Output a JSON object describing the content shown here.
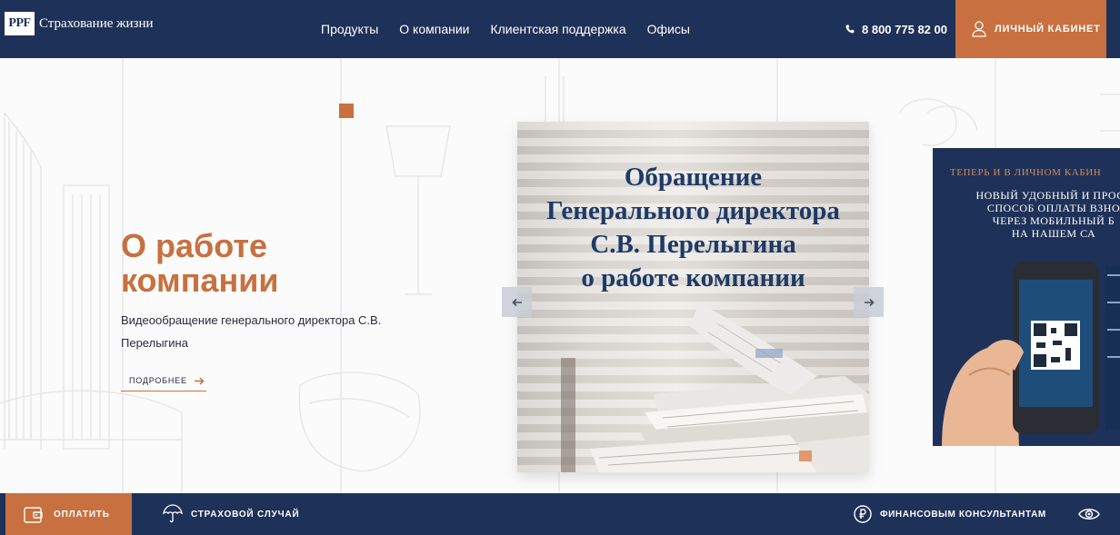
{
  "header": {
    "logo_mark": "PPF",
    "logo_text": "Страхование жизни",
    "nav": [
      "Продукты",
      "О компании",
      "Клиентская поддержка",
      "Офисы"
    ],
    "phone": "8 800 775 82 00",
    "cabinet_label": "ЛИЧНЫЙ КАБИНЕТ"
  },
  "hero": {
    "title_line1": "О работе",
    "title_line2": "компании",
    "description": "Видеообращение генерального директора С.В. Перелыгина",
    "more_label": "ПОДРОБНЕЕ"
  },
  "slider": {
    "main_slide": {
      "line1": "Обращение",
      "line2": "Генерального директора",
      "line3": "С.В. Перелыгина",
      "line4": "о работе компании"
    },
    "next_slide": {
      "title": "ТЕПЕРЬ И В ЛИЧНОМ КАБИН",
      "line1": "НОВЫЙ УДОБНЫЙ И ПРОСТ",
      "line2": "СПОСОБ ОПЛАТЫ ВЗНО",
      "line3": "ЧЕРЕЗ МОБИЛЬНЫЙ Б",
      "line4": "НА НАШЕМ СА"
    }
  },
  "bottombar": {
    "pay_label": "ОПЛАТИТЬ",
    "insured_label": "СТРАХОВОЙ СЛУЧАЙ",
    "advisors_label": "ФИНАНСОВЫМ КОНСУЛЬТАНТАМ"
  },
  "colors": {
    "navy": "#1e3158",
    "accent": "#c8703f",
    "chat": "#1a9ee0"
  }
}
